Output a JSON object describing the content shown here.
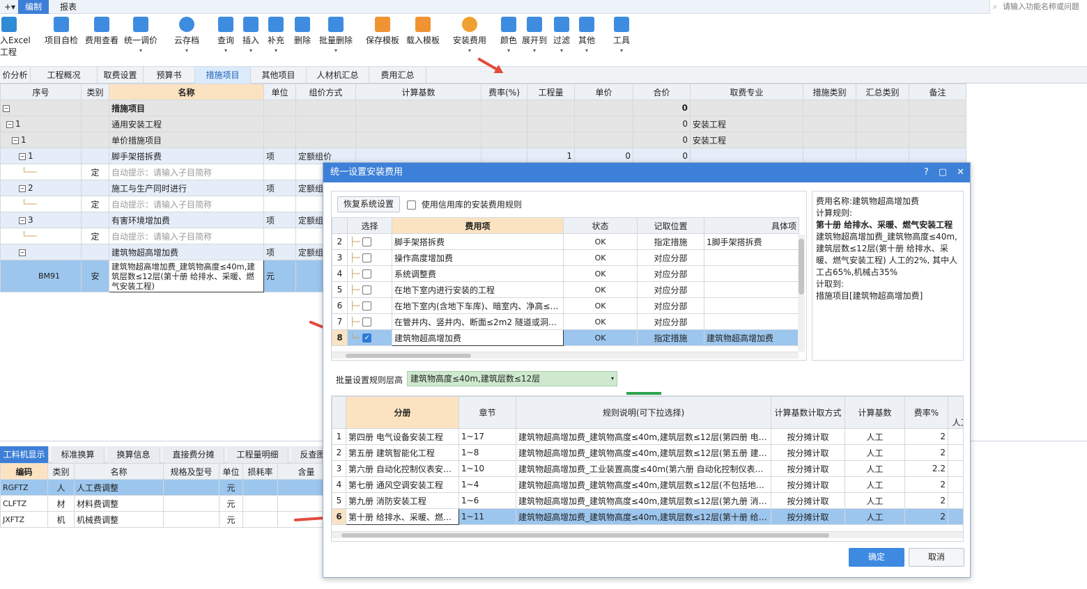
{
  "menu": {
    "items": [
      {
        "label": "+▾"
      },
      {
        "label": "编制"
      },
      {
        "label": "报表"
      }
    ],
    "search_placeholder": "请输入功能名称或问题"
  },
  "ribbon": [
    {
      "label": "入Excel",
      "sub": "工程",
      "icon": "excel-icon"
    },
    {
      "label": "项目自检",
      "icon": "check-icon"
    },
    {
      "label": "费用查看",
      "icon": "cost-view-icon"
    },
    {
      "label": "统一调价",
      "icon": "price-adjust-icon"
    },
    {
      "label": "云存档",
      "icon": "cloud-icon"
    },
    {
      "label": "查询",
      "icon": "query-icon"
    },
    {
      "label": "插入",
      "icon": "insert-icon"
    },
    {
      "label": "补充",
      "icon": "supplement-icon"
    },
    {
      "label": "删除",
      "icon": "delete-icon"
    },
    {
      "label": "批量删除",
      "icon": "batch-delete-icon"
    },
    {
      "label": "保存模板",
      "icon": "save-template-icon"
    },
    {
      "label": "载入模板",
      "icon": "load-template-icon"
    },
    {
      "label": "安装费用",
      "icon": "install-cost-icon"
    },
    {
      "label": "颜色",
      "icon": "color-icon"
    },
    {
      "label": "展开到",
      "icon": "expand-icon"
    },
    {
      "label": "过滤",
      "icon": "filter-icon"
    },
    {
      "label": "其他",
      "icon": "other-icon"
    },
    {
      "label": "工具",
      "icon": "tool-icon"
    }
  ],
  "page_tabs": [
    "价分析",
    "工程概况",
    "取费设置",
    "预算书",
    "措施项目",
    "其他项目",
    "人材机汇总",
    "费用汇总"
  ],
  "active_page_tab": "措施项目",
  "main_table": {
    "headers": [
      "序号",
      "类别",
      "名称",
      "单位",
      "组价方式",
      "计算基数",
      "费率(%)",
      "工程量",
      "单价",
      "合价",
      "取费专业",
      "措施类别",
      "汇总类别",
      "备注"
    ],
    "rows": [
      {
        "seq": "",
        "type": "",
        "name": "措施项目",
        "unit": "",
        "method": "",
        "total": "0",
        "major": ""
      },
      {
        "seq": "1",
        "type": "",
        "name": "通用安装工程",
        "unit": "",
        "method": "",
        "total": "0",
        "major": "安装工程"
      },
      {
        "seq": "1",
        "type": "",
        "name": "单价措施项目",
        "unit": "",
        "method": "",
        "total": "0",
        "major": "安装工程"
      },
      {
        "seq": "1",
        "type": "",
        "name": "脚手架搭拆费",
        "unit": "项",
        "method": "定额组价",
        "qty": "1",
        "price": "0",
        "total": "0",
        "major": ""
      },
      {
        "seq": "",
        "type": "定",
        "name": "自动提示：请输入子目简称",
        "unit": "",
        "method": ""
      },
      {
        "seq": "2",
        "type": "",
        "name": "施工与生产同时进行",
        "unit": "项",
        "method": "定额组"
      },
      {
        "seq": "",
        "type": "定",
        "name": "自动提示：请输入子目简称",
        "unit": "",
        "method": ""
      },
      {
        "seq": "3",
        "type": "",
        "name": "有害环境增加费",
        "unit": "项",
        "method": "定额组"
      },
      {
        "seq": "",
        "type": "定",
        "name": "自动提示：请输入子目简称",
        "unit": "",
        "method": ""
      },
      {
        "seq": "",
        "type": "",
        "name": "建筑物超高增加费",
        "unit": "项",
        "method": "定额组"
      },
      {
        "seq": "BM91",
        "type": "安",
        "name": "建筑物超高增加费_建筑物高度≤40m,建筑层数≤12层(第十册 给排水、采暖、燃气安装工程)",
        "unit": "元",
        "method": ""
      }
    ]
  },
  "bottom_tabs": [
    "工料机显示",
    "标准换算",
    "换算信息",
    "直接费分摊",
    "工程量明细",
    "反查图"
  ],
  "bottom_table": {
    "headers": [
      "编码",
      "类别",
      "名称",
      "规格及型号",
      "单位",
      "损耗率",
      "含量"
    ],
    "rows": [
      {
        "code": "RGFTZ",
        "type": "人",
        "name": "人工费调整",
        "unit": "元"
      },
      {
        "code": "CLFTZ",
        "type": "材",
        "name": "材料费调整",
        "unit": "元"
      },
      {
        "code": "JXFTZ",
        "type": "机",
        "name": "机械费调整",
        "unit": "元"
      }
    ]
  },
  "dialog": {
    "title": "统一设置安装费用",
    "restore_button": "恢复系统设置",
    "use_credit_label": "使用信用库的安装费用规则",
    "fee_table": {
      "headers": [
        "选择",
        "费用项",
        "状态",
        "记取位置",
        "具体项"
      ],
      "rows": [
        {
          "no": "2",
          "checked": false,
          "item": "脚手架搭拆费",
          "status": "OK",
          "pos": "指定措施",
          "detail": "1脚手架搭拆费"
        },
        {
          "no": "3",
          "checked": false,
          "item": "操作高度增加费",
          "status": "OK",
          "pos": "对应分部",
          "detail": ""
        },
        {
          "no": "4",
          "checked": false,
          "item": "系统调整费",
          "status": "OK",
          "pos": "对应分部",
          "detail": ""
        },
        {
          "no": "5",
          "checked": false,
          "item": "在地下室内进行安装的工程",
          "status": "OK",
          "pos": "对应分部",
          "detail": ""
        },
        {
          "no": "6",
          "checked": false,
          "item": "在地下室内(含地下车库)、暗室内、净高≤…",
          "status": "OK",
          "pos": "对应分部",
          "detail": ""
        },
        {
          "no": "7",
          "checked": false,
          "item": "在管井内、竖井内、断面≤2m2 隧道或洞内…",
          "status": "OK",
          "pos": "对应分部",
          "detail": ""
        },
        {
          "no": "8",
          "checked": true,
          "item": "建筑物超高增加费",
          "status": "OK",
          "pos": "指定措施",
          "detail": "建筑物超高增加费"
        }
      ]
    },
    "info": {
      "name_line": "费用名称:建筑物超高增加费",
      "rule_label": "计算规则:",
      "rule_bold": "第十册 给排水、采暖、燃气安装工程",
      "rule_text": "建筑物超高增加费_建筑物高度≤40m,建筑层数≤12层(第十册 给排水、采暖、燃气安装工程) 人工的2%, 其中人工占65%,机械占35%",
      "take_label": "计取到:",
      "take_value": "措施项目[建筑物超高增加费]"
    },
    "batch_label": "批量设置规则层高",
    "batch_value": "建筑物高度≤40m,建筑层数≤12层",
    "rule_table": {
      "headers": [
        "分册",
        "章节",
        "规则说明(可下拉选择)",
        "计算基数计取方式",
        "计算基数",
        "费率%",
        "人工"
      ],
      "rows": [
        {
          "no": "1",
          "book": "第四册 电气设备安装工程",
          "chapter": "1~17",
          "rule": "建筑物超高增加费_建筑物高度≤40m,建筑层数≤12层(第四册 电…",
          "mode": "按分摊计取",
          "base": "人工",
          "rate": "2"
        },
        {
          "no": "2",
          "book": "第五册 建筑智能化工程",
          "chapter": "1~8",
          "rule": "建筑物超高增加费_建筑物高度≤40m,建筑层数≤12层(第五册 建…",
          "mode": "按分摊计取",
          "base": "人工",
          "rate": "2"
        },
        {
          "no": "3",
          "book": "第六册 自动化控制仪表安…",
          "chapter": "1~10",
          "rule": "建筑物超高增加费_工业装置高度≤40m(第六册 自动化控制仪表安…",
          "mode": "按分摊计取",
          "base": "人工",
          "rate": "2.2"
        },
        {
          "no": "4",
          "book": "第七册 通风空调安装工程",
          "chapter": "1~4",
          "rule": "建筑物超高增加费_建筑物高度≤40m,建筑层数≤12层(不包括地下…",
          "mode": "按分摊计取",
          "base": "人工",
          "rate": "2"
        },
        {
          "no": "5",
          "book": "第九册 消防安装工程",
          "chapter": "1~6",
          "rule": "建筑物超高增加费_建筑物高度≤40m,建筑层数≤12层(第九册 消…",
          "mode": "按分摊计取",
          "base": "人工",
          "rate": "2"
        },
        {
          "no": "6",
          "book": "第十册 给排水、采暖、燃…",
          "chapter": "1~11",
          "rule": "建筑物超高增加费_建筑物高度≤40m,建筑层数≤12层(第十册 给…",
          "mode": "按分摊计取",
          "base": "人工",
          "rate": "2"
        }
      ]
    },
    "ok_button": "确定",
    "cancel_button": "取消"
  }
}
